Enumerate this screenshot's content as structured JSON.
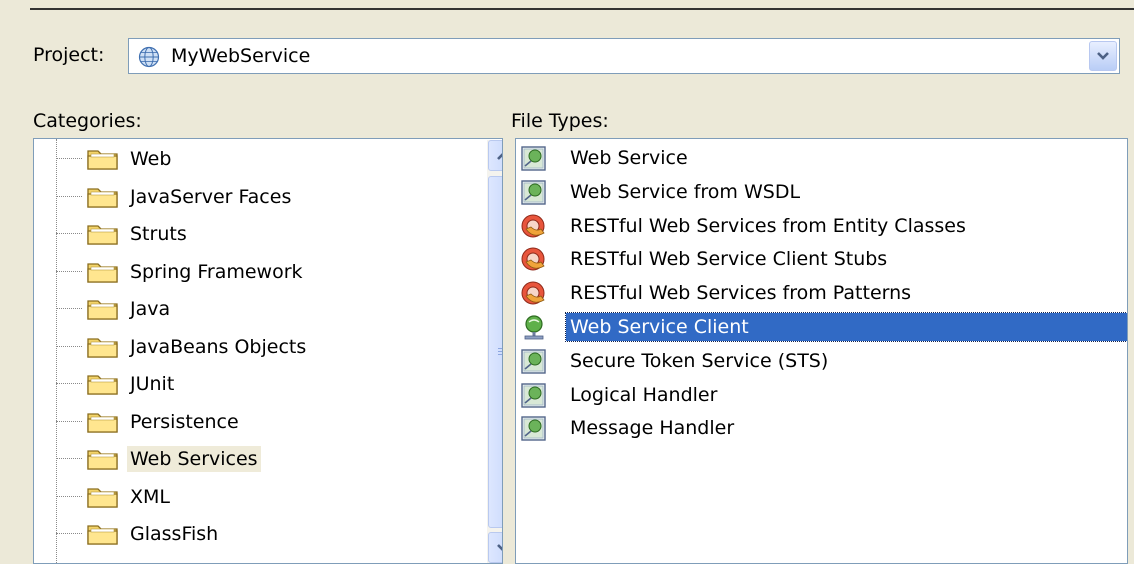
{
  "project": {
    "label": "Project:",
    "value": "MyWebService",
    "icon": "globe-icon"
  },
  "categories": {
    "label": "Categories:",
    "items": [
      {
        "label": "Web"
      },
      {
        "label": "JavaServer Faces"
      },
      {
        "label": "Struts"
      },
      {
        "label": "Spring Framework"
      },
      {
        "label": "Java"
      },
      {
        "label": "JavaBeans Objects"
      },
      {
        "label": "JUnit"
      },
      {
        "label": "Persistence"
      },
      {
        "label": "Web Services",
        "selected": true
      },
      {
        "label": "XML"
      },
      {
        "label": "GlassFish"
      }
    ]
  },
  "file_types": {
    "label": "File Types:",
    "items": [
      {
        "label": "Web Service",
        "icon": "web-service-icon"
      },
      {
        "label": "Web Service from WSDL",
        "icon": "web-service-icon"
      },
      {
        "label": "RESTful Web Services from Entity Classes",
        "icon": "restful-icon"
      },
      {
        "label": "RESTful Web Service Client Stubs",
        "icon": "restful-icon"
      },
      {
        "label": "RESTful Web Services from Patterns",
        "icon": "restful-icon"
      },
      {
        "label": "Web Service Client",
        "icon": "web-service-client-icon",
        "selected": true
      },
      {
        "label": "Secure Token Service (STS)",
        "icon": "web-service-icon"
      },
      {
        "label": "Logical Handler",
        "icon": "web-service-icon"
      },
      {
        "label": "Message Handler",
        "icon": "web-service-icon"
      }
    ]
  },
  "colors": {
    "selection": "#316ac5",
    "category_highlight": "#efebd9",
    "dialog_background": "#ece9d8"
  }
}
